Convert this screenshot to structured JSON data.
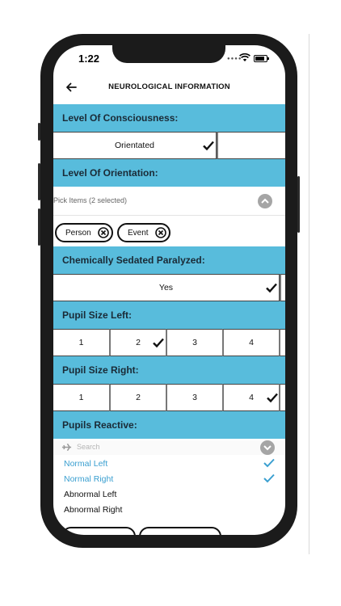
{
  "status_bar": {
    "time": "1:22"
  },
  "header": {
    "title": "NEUROLOGICAL INFORMATION"
  },
  "sections": {
    "consciousness": "Level Of Consciousness:",
    "orientation": "Level Of Orientation:",
    "sedated": "Chemically Sedated Paralyzed:",
    "pupil_left": "Pupil Size Left:",
    "pupil_right": "Pupil Size Right:",
    "pupils_reactive": "Pupils Reactive:"
  },
  "consciousness": {
    "selected_label": "Orientated"
  },
  "orientation": {
    "picker_text": "Pick Items (2 selected)",
    "chips": [
      "Person",
      "Event"
    ]
  },
  "sedated": {
    "selected_label": "Yes"
  },
  "pupil_left": {
    "options": [
      "1",
      "2",
      "3",
      "4"
    ],
    "selected": "2"
  },
  "pupil_right": {
    "options": [
      "1",
      "2",
      "3",
      "4"
    ],
    "selected": "4"
  },
  "pupils_reactive": {
    "search_placeholder": "Search",
    "options": [
      {
        "label": "Normal Left",
        "selected": true
      },
      {
        "label": "Normal Right",
        "selected": true
      },
      {
        "label": "Abnormal Left",
        "selected": false
      },
      {
        "label": "Abnormal Right",
        "selected": false
      }
    ]
  },
  "icons": [
    "back-arrow-icon",
    "checkmark-icon",
    "chevron-up-icon",
    "chevron-down-icon",
    "close-circle-icon",
    "airplane-icon",
    "wifi-icon",
    "battery-icon"
  ],
  "colors": {
    "section_header": "#58bcdc",
    "selected_option": "#3a9fd0",
    "checkmark_blue": "#3a9fd0"
  }
}
